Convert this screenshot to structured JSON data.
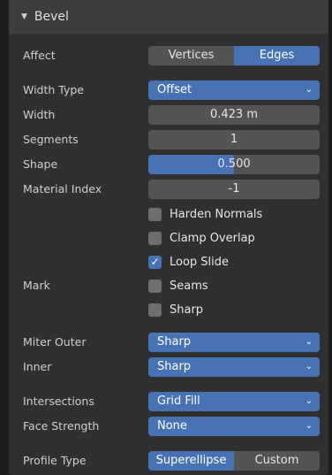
{
  "panel": {
    "title": "Bevel",
    "toggle_glyph": "▼"
  },
  "affect": {
    "label": "Affect",
    "options": [
      "Vertices",
      "Edges"
    ],
    "selected": "Edges"
  },
  "width_type": {
    "label": "Width Type",
    "value": "Offset"
  },
  "width": {
    "label": "Width",
    "value": "0.423 m"
  },
  "segments": {
    "label": "Segments",
    "value": "1"
  },
  "shape": {
    "label": "Shape",
    "value": "0.500",
    "fraction": 0.5
  },
  "material_index": {
    "label": "Material Index",
    "value": "-1"
  },
  "checkboxes": [
    {
      "label": "Harden Normals",
      "checked": false
    },
    {
      "label": "Clamp Overlap",
      "checked": false
    },
    {
      "label": "Loop Slide",
      "checked": true
    }
  ],
  "mark": {
    "label": "Mark",
    "items": [
      {
        "label": "Seams",
        "checked": false
      },
      {
        "label": "Sharp",
        "checked": false
      }
    ]
  },
  "miter_outer": {
    "label": "Miter Outer",
    "value": "Sharp"
  },
  "inner": {
    "label": "Inner",
    "value": "Sharp"
  },
  "intersections": {
    "label": "Intersections",
    "value": "Grid Fill"
  },
  "face_strength": {
    "label": "Face Strength",
    "value": "None"
  },
  "profile_type": {
    "label": "Profile Type",
    "options": [
      "Superellipse",
      "Custom"
    ],
    "selected": "Superellipse"
  },
  "icons": {
    "dropdown": "chevron-down-icon",
    "check": "checkmark-icon"
  },
  "colors": {
    "accent": "#4772b3",
    "field": "#545454",
    "panel": "#303030"
  }
}
